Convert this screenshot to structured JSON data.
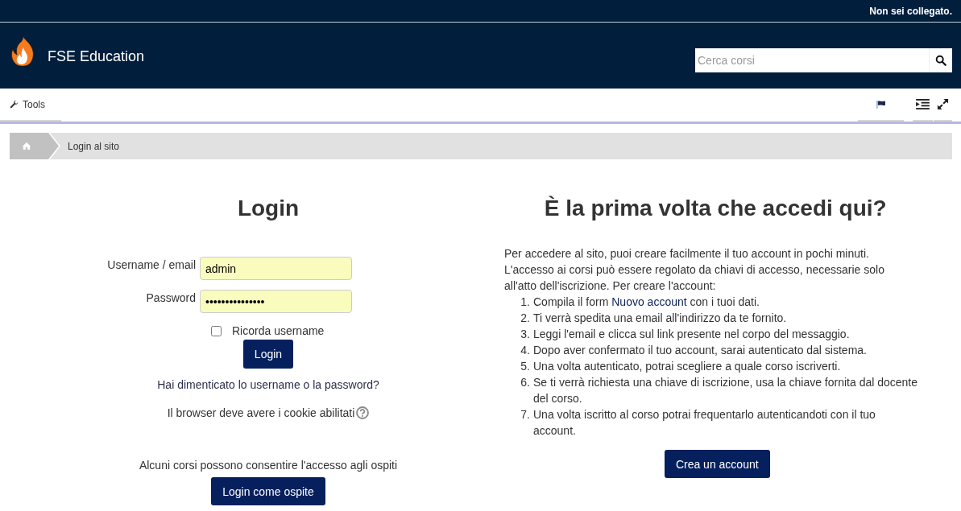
{
  "top_bar": {
    "login_status": "Non sei collegato."
  },
  "header": {
    "site_name": "FSE Education",
    "search": {
      "placeholder": "Cerca corsi"
    }
  },
  "nav": {
    "tools": "Tools"
  },
  "breadcrumb": {
    "items": [
      "Login al sito"
    ]
  },
  "login": {
    "title": "Login",
    "fields": [
      {
        "kind": "text",
        "label": "Username / email",
        "value": "admin"
      },
      {
        "kind": "password",
        "label": "Password",
        "value": "•••••••••••••••"
      }
    ],
    "remember": {
      "label": "Ricorda username",
      "checked": false
    },
    "submit": "Login",
    "forgot_link": "Hai dimenticato lo username o la password?",
    "cookies_note": "Il browser deve avere i cookie abilitati",
    "guest_note": "Alcuni corsi possono consentire l'accesso agli ospiti",
    "guest_button": "Login come ospite"
  },
  "signup": {
    "title": "È la prima volta che accedi qui?",
    "intro": [
      "Per accedere al sito, puoi creare facilmente il tuo account in pochi minuti.",
      "L'accesso ai corsi può essere regolato da chiavi di accesso, necessarie solo all'atto dell'iscrizione. Per creare l'account:"
    ],
    "steps": [
      {
        "number": "1.",
        "parts": [
          {
            "kind": "text",
            "text": "Compila il form "
          },
          {
            "kind": "link",
            "text": "Nuovo account"
          },
          {
            "kind": "text",
            "text": " con i tuoi dati."
          }
        ]
      },
      {
        "number": "2.",
        "parts": [
          {
            "kind": "text",
            "text": "Ti verrà spedita una email all'indirizzo da te fornito."
          }
        ]
      },
      {
        "number": "3.",
        "parts": [
          {
            "kind": "text",
            "text": "Leggi l'email e clicca sul link presente nel corpo del messaggio."
          }
        ]
      },
      {
        "number": "4.",
        "parts": [
          {
            "kind": "text",
            "text": "Dopo aver confermato il tuo account, sarai autenticato dal sistema."
          }
        ]
      },
      {
        "number": "5.",
        "parts": [
          {
            "kind": "text",
            "text": "Una volta autenticato, potrai scegliere a quale corso iscriverti."
          }
        ]
      },
      {
        "number": "6.",
        "parts": [
          {
            "kind": "text",
            "text": "Se ti verrà richiesta una chiave di iscrizione, usa la chiave fornita dal docente del corso."
          }
        ]
      },
      {
        "number": "7.",
        "parts": [
          {
            "kind": "text",
            "text": "Una volta iscritto al corso potrai frequentarlo autenticandoti con il tuo account."
          }
        ]
      }
    ],
    "button": "Crea un account"
  }
}
